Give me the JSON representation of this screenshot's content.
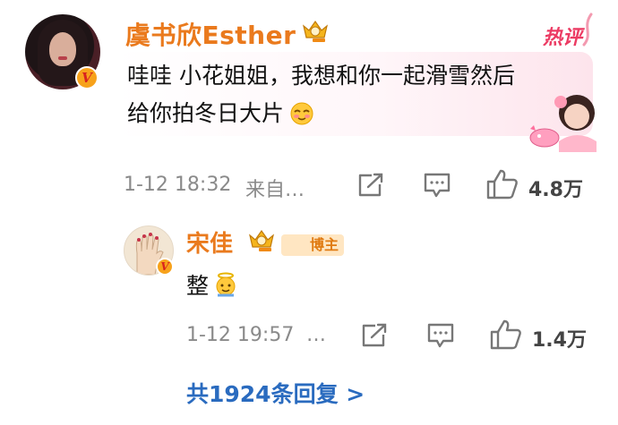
{
  "main_comment": {
    "username": "虞书欣Esther",
    "tag": "热评",
    "text_line1": "哇哇 小花姐姐，我想和你一起滑雪然后",
    "text_line2": "给你拍冬日大片",
    "verified_mark": "V",
    "time": "1-12 18:32",
    "source": "来自…",
    "likes": "4.8万"
  },
  "reply": {
    "username": "宋佳",
    "badge": "博主",
    "text": "整",
    "verified_mark": "V",
    "time": "1-12 19:57",
    "source": "…",
    "likes": "1.4万"
  },
  "footer": {
    "more_replies": "共1924条回复 >"
  },
  "colors": {
    "username": "#ea7a1d",
    "link": "#2a6bbf",
    "hot": "#ec3b63",
    "meta": "#8a8a8a"
  },
  "icons": [
    "share-icon",
    "comment-icon",
    "like-icon",
    "crown-badge-icon",
    "verified-badge-icon",
    "emoji-cool-icon",
    "emoji-angel-icon"
  ]
}
